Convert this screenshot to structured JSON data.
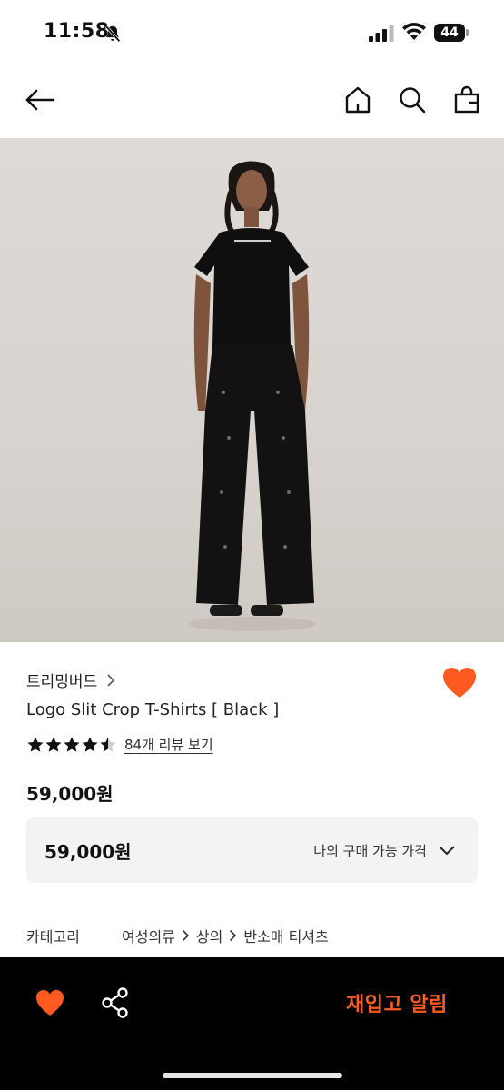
{
  "status_bar": {
    "time": "11:58",
    "battery": "44",
    "icons": [
      "bell-muted-icon",
      "cellular-signal-icon",
      "wifi-icon",
      "battery-icon"
    ]
  },
  "nav": {
    "icons": [
      "back-arrow-icon",
      "home-icon",
      "search-icon",
      "shopping-bag-icon"
    ]
  },
  "product": {
    "image_icon": "product-photo",
    "brand": "트리밍버드",
    "name": "Logo Slit Crop T-Shirts [ Black ]",
    "rating": 4.5,
    "review_link": "84개 리뷰 보기",
    "price": "59,000원",
    "purchasable_price": {
      "value": "59,000원",
      "label": "나의 구매 가능 가격"
    },
    "category": {
      "label": "카테고리",
      "path": [
        "여성의류",
        "상의",
        "반소매 티셔츠"
      ]
    }
  },
  "bottom_bar": {
    "restock_label": "재입고 알림",
    "icons": [
      "heart-icon",
      "share-icon"
    ]
  },
  "colors": {
    "accent": "#ff5a1f",
    "bottom_bar_bg": "#000000",
    "price_box_bg": "#f3f3f4"
  }
}
